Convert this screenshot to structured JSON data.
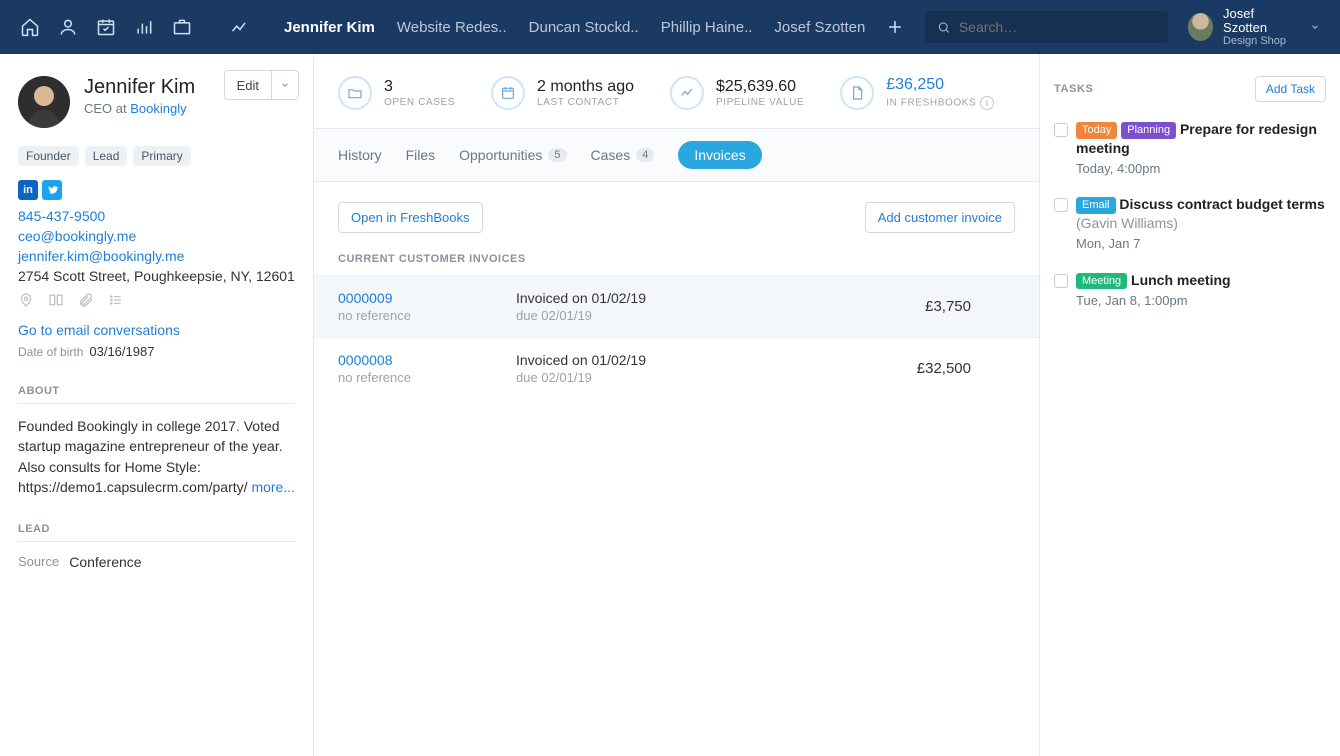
{
  "nav": {
    "tabs": [
      "Jennifer Kim",
      "Website Redes..",
      "Duncan Stockd..",
      "Phillip Haine..",
      "Josef Szotten"
    ],
    "active_tab_index": 0,
    "search_placeholder": "Search…",
    "user": {
      "name": "Josef Szotten",
      "org": "Design Shop"
    }
  },
  "person": {
    "name": "Jennifer Kim",
    "title_prefix": "CEO at ",
    "company": "Bookingly",
    "edit": "Edit",
    "chips": [
      "Founder",
      "Lead",
      "Primary"
    ],
    "phone": "845-437-9500",
    "email1": "ceo@bookingly.me",
    "email2": "jennifer.kim@bookingly.me",
    "address": "2754 Scott Street, Poughkeepsie, NY, 12601",
    "goto": "Go to email conversations",
    "dob_label": "Date of birth",
    "dob": "03/16/1987",
    "about_h": "ABOUT",
    "about": "Founded Bookingly in college 2017. Voted startup magazine entrepreneur of the year. Also consults for Home Style: https://demo1.capsulecrm.com/party/ ",
    "more": "more...",
    "lead_h": "LEAD",
    "lead_source_label": "Source",
    "lead_source": "Conference"
  },
  "stats": {
    "open_cases": {
      "value": "3",
      "label": "OPEN CASES"
    },
    "last_contact": {
      "value": "2 months ago",
      "label": "LAST CONTACT"
    },
    "pipeline": {
      "value": "$25,639.60",
      "label": "PIPELINE VALUE"
    },
    "freshbooks": {
      "value": "£36,250",
      "label": "IN FRESHBOOKS"
    }
  },
  "tabs": {
    "history": "History",
    "files": "Files",
    "opportunities": "Opportunities",
    "opportunities_count": "5",
    "cases": "Cases",
    "cases_count": "4",
    "invoices": "Invoices"
  },
  "actions": {
    "open_fb": "Open in FreshBooks",
    "add_inv": "Add customer invoice"
  },
  "invoices": {
    "heading": "CURRENT CUSTOMER INVOICES",
    "rows": [
      {
        "num": "0000009",
        "ref": "no reference",
        "line1": "Invoiced on 01/02/19",
        "line2": "due 02/01/19",
        "amount": "£3,750"
      },
      {
        "num": "0000008",
        "ref": "no reference",
        "line1": "Invoiced on 01/02/19",
        "line2": "due 02/01/19",
        "amount": "£32,500"
      }
    ]
  },
  "tasks": {
    "heading": "TASKS",
    "add": "Add Task",
    "items": [
      {
        "pills": [
          {
            "cls": "today",
            "txt": "Today"
          },
          {
            "cls": "planning",
            "txt": "Planning"
          }
        ],
        "title": "Prepare for redesign meeting",
        "who": "",
        "when": "Today, 4:00pm"
      },
      {
        "pills": [
          {
            "cls": "email",
            "txt": "Email"
          }
        ],
        "title": "Discuss contract budget terms",
        "who": "(Gavin Williams)",
        "when": "Mon, Jan 7"
      },
      {
        "pills": [
          {
            "cls": "meeting",
            "txt": "Meeting"
          }
        ],
        "title": "Lunch meeting",
        "who": "",
        "when": "Tue, Jan 8, 1:00pm"
      }
    ]
  }
}
